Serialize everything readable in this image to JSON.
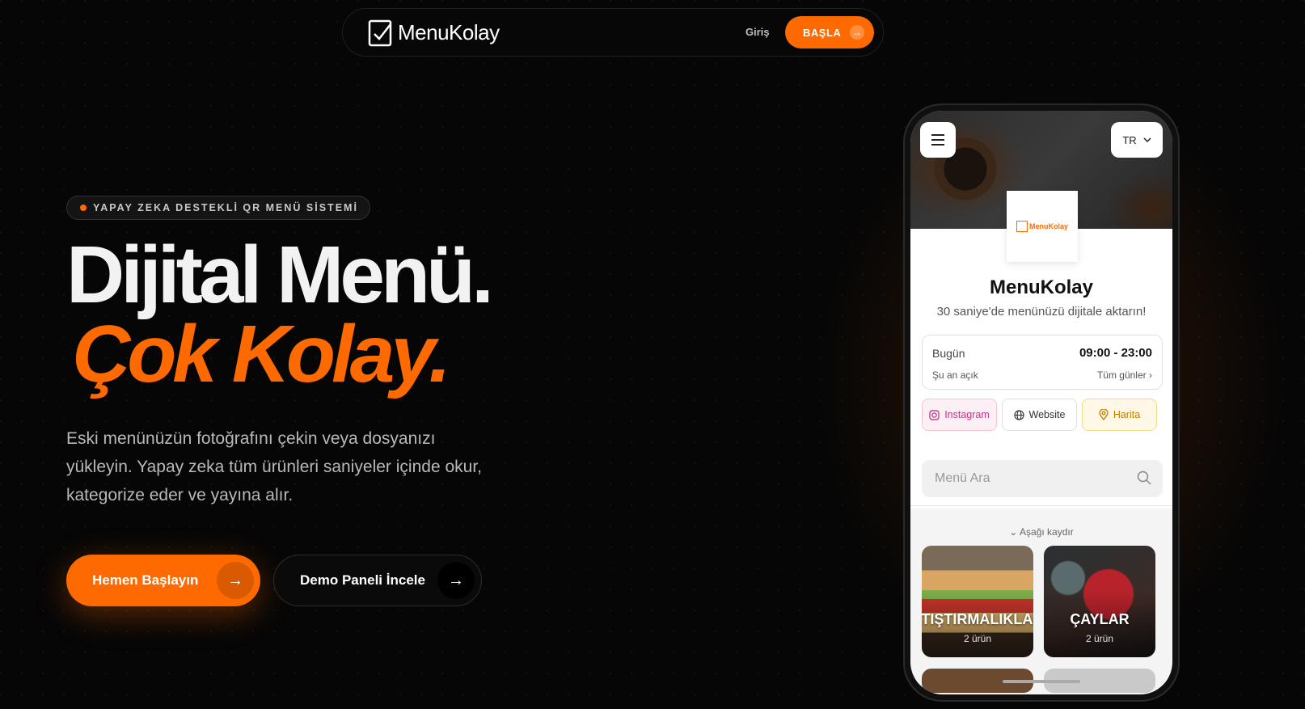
{
  "nav": {
    "brand": "MenuKolay",
    "login_label": "Giriş",
    "start_label": "BAŞLA"
  },
  "hero": {
    "badge": "YAPAY ZEKA DESTEKLİ QR MENÜ SİSTEMİ",
    "title_line1": "Dijital Menü.",
    "title_line2": "Çok Kolay.",
    "description": "Eski menünüzün fotoğrafını çekin veya dosyanızı yükleyin. Yapay zeka tüm ürünleri saniyeler içinde okur, kategorize eder ve yayına alır.",
    "primary_button": "Hemen Başlayın",
    "secondary_button": "Demo Paneli İncele"
  },
  "phone": {
    "language": "TR",
    "logo_text": "MenuKolay",
    "business_name": "MenuKolay",
    "tagline": "30 saniye'de menünüzü dijitale aktarın!",
    "hours": {
      "day_label": "Bugün",
      "time": "09:00 - 23:00",
      "status": "Şu an açık",
      "all_days": "Tüm günler"
    },
    "links": {
      "instagram": "Instagram",
      "website": "Website",
      "map": "Harita"
    },
    "search_placeholder": "Menü Ara",
    "scroll_hint": "Aşağı kaydır",
    "categories": [
      {
        "name": "ATIŞTIRMALIKLAR",
        "count": "2 ürün"
      },
      {
        "name": "ÇAYLAR",
        "count": "2 ürün"
      }
    ]
  },
  "colors": {
    "accent": "#ff6a00",
    "background": "#060606"
  }
}
